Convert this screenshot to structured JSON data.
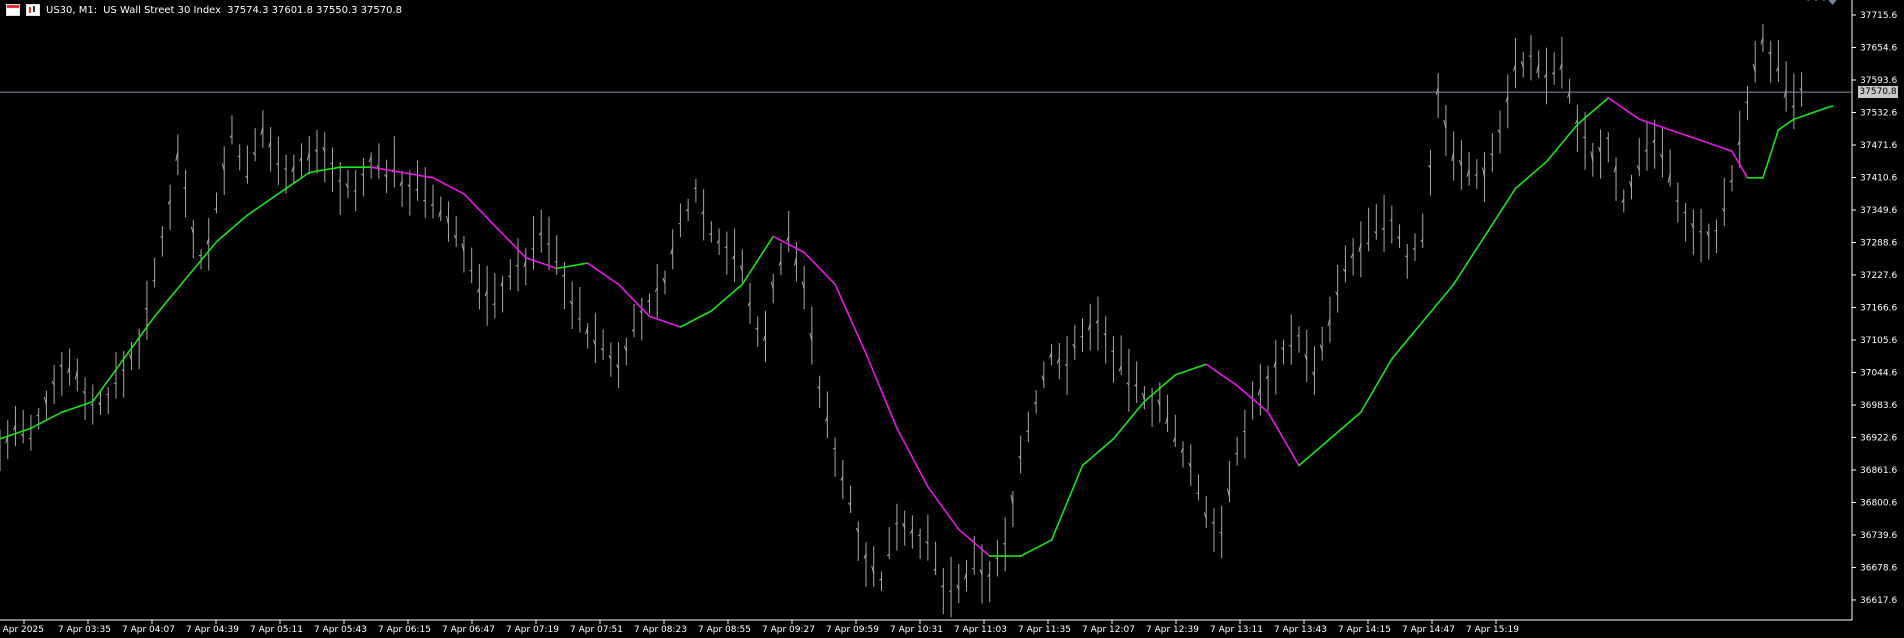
{
  "header": {
    "symbol_label": "US30, M1:",
    "description": "US Wall Street 30 Index",
    "ohlc": "37574.3 37601.8 37550.3 37570.8"
  },
  "colors": {
    "background": "#000000",
    "bars": "#a8a8a8",
    "ma_up": "#19e619",
    "ma_down": "#e619e6",
    "axis_text": "#ffffff",
    "price_line": "#8a95a5"
  },
  "chart_data": {
    "type": "line",
    "title": "US30, M1: US Wall Street 30 Index",
    "xlabel": "",
    "ylabel": "",
    "ylim": [
      36580,
      37740
    ],
    "y_ticks": [
      "37715.6",
      "37654.6",
      "37593.6",
      "37532.6",
      "37471.6",
      "37410.6",
      "37349.6",
      "37288.6",
      "37227.6",
      "37166.6",
      "37105.6",
      "37044.6",
      "36983.6",
      "36922.6",
      "36861.6",
      "36800.6",
      "36739.6",
      "36678.6",
      "36617.6"
    ],
    "x_ticks": [
      "7 Apr 2025",
      "7 Apr 03:35",
      "7 Apr 04:07",
      "7 Apr 04:39",
      "7 Apr 05:11",
      "7 Apr 05:43",
      "7 Apr 06:15",
      "7 Apr 06:47",
      "7 Apr 07:19",
      "7 Apr 07:51",
      "7 Apr 08:23",
      "7 Apr 08:55",
      "7 Apr 09:27",
      "7 Apr 09:59",
      "7 Apr 10:31",
      "7 Apr 11:03",
      "7 Apr 11:35",
      "7 Apr 12:07",
      "7 Apr 12:39",
      "7 Apr 13:11",
      "7 Apr 13:43",
      "7 Apr 14:15",
      "7 Apr 14:47",
      "7 Apr 15:19"
    ],
    "current_price": "37570.8",
    "current_price_value": 37570.8,
    "price_series": {
      "x": [
        0,
        2,
        4,
        6,
        8,
        10,
        12,
        14,
        16,
        18,
        20,
        22,
        23,
        24,
        25,
        26,
        27,
        28,
        29,
        30,
        32,
        34,
        36,
        38,
        40,
        42,
        44,
        46,
        48,
        50,
        51,
        52,
        54,
        56,
        58,
        60,
        62,
        64,
        66,
        68,
        70,
        72,
        74,
        76,
        78,
        80,
        82,
        84,
        86,
        88,
        90,
        92,
        94,
        96,
        97,
        98,
        99,
        100,
        102,
        104,
        106,
        108,
        110,
        112,
        114,
        116,
        118,
        120,
        122,
        124,
        126,
        128,
        130,
        132,
        134,
        136,
        138,
        140,
        142,
        144,
        146,
        148,
        150,
        152,
        154,
        156,
        158,
        160,
        162,
        164,
        166,
        168,
        170,
        172,
        174,
        176,
        178,
        180,
        182,
        184,
        186,
        188,
        190,
        192,
        194,
        196,
        198,
        200,
        202,
        204,
        206,
        208,
        210,
        212,
        214,
        216,
        218,
        220,
        222,
        224,
        226,
        228,
        230,
        231,
        232,
        233,
        234,
        235,
        236,
        237
      ],
      "y": [
        36900,
        36940,
        36920,
        36990,
        37060,
        37040,
        36980,
        37000,
        37050,
        37100,
        37220,
        37370,
        37450,
        37390,
        37310,
        37260,
        37290,
        37360,
        37430,
        37490,
        37420,
        37500,
        37440,
        37430,
        37450,
        37460,
        37400,
        37380,
        37440,
        37420,
        37430,
        37400,
        37390,
        37360,
        37330,
        37280,
        37200,
        37180,
        37230,
        37250,
        37310,
        37260,
        37180,
        37120,
        37090,
        37060,
        37130,
        37170,
        37220,
        37320,
        37390,
        37310,
        37280,
        37240,
        37170,
        37130,
        37110,
        37210,
        37300,
        37210,
        37010,
        36900,
        36800,
        36700,
        36650,
        36770,
        36750,
        36720,
        36640,
        36640,
        36680,
        36660,
        36720,
        36890,
        36990,
        37080,
        37060,
        37120,
        37140,
        37080,
        37030,
        37000,
        36990,
        36920,
        36870,
        36780,
        36750,
        36890,
        36990,
        37030,
        37090,
        37110,
        37040,
        37140,
        37240,
        37280,
        37310,
        37330,
        37260,
        37300,
        37570,
        37450,
        37420,
        37420,
        37500,
        37620,
        37630,
        37600,
        37620,
        37510,
        37450,
        37480,
        37370,
        37430,
        37480,
        37410,
        37340,
        37300,
        37310,
        37400,
        37560,
        37670,
        37610,
        37570,
        37550,
        37570
      ]
    },
    "series": [
      {
        "x": [
          0,
          4,
          8,
          12,
          16,
          20,
          24,
          28,
          32,
          36,
          40,
          44,
          48,
          52,
          56,
          60,
          64,
          68,
          72,
          76,
          80,
          84,
          88,
          92,
          96,
          100,
          104,
          108,
          112,
          116,
          120,
          124,
          128,
          132,
          136,
          140,
          144,
          148,
          152,
          156,
          160,
          164,
          168,
          172,
          176,
          180,
          184,
          188,
          192,
          196,
          200,
          204,
          208,
          212,
          216,
          220,
          224,
          226,
          228,
          230,
          232,
          234,
          236,
          237
        ],
        "y": [
          36920,
          36940,
          36970,
          36990,
          37070,
          37150,
          37220,
          37290,
          37340,
          37380,
          37420,
          37430,
          37430,
          37420,
          37410,
          37380,
          37320,
          37260,
          37240,
          37250,
          37210,
          37150,
          37130,
          37160,
          37210,
          37300,
          37270,
          37210,
          37080,
          36940,
          36830,
          36750,
          36700,
          36700,
          36730,
          36870,
          36920,
          36990,
          37040,
          37060,
          37020,
          36970,
          36870,
          36920,
          36970,
          37070,
          37140,
          37210,
          37300,
          37390,
          37440,
          37510,
          37560,
          37520,
          37500,
          37480,
          37460,
          37410,
          37410,
          37500,
          37520,
          37530,
          37540,
          37545
        ]
      }
    ]
  }
}
